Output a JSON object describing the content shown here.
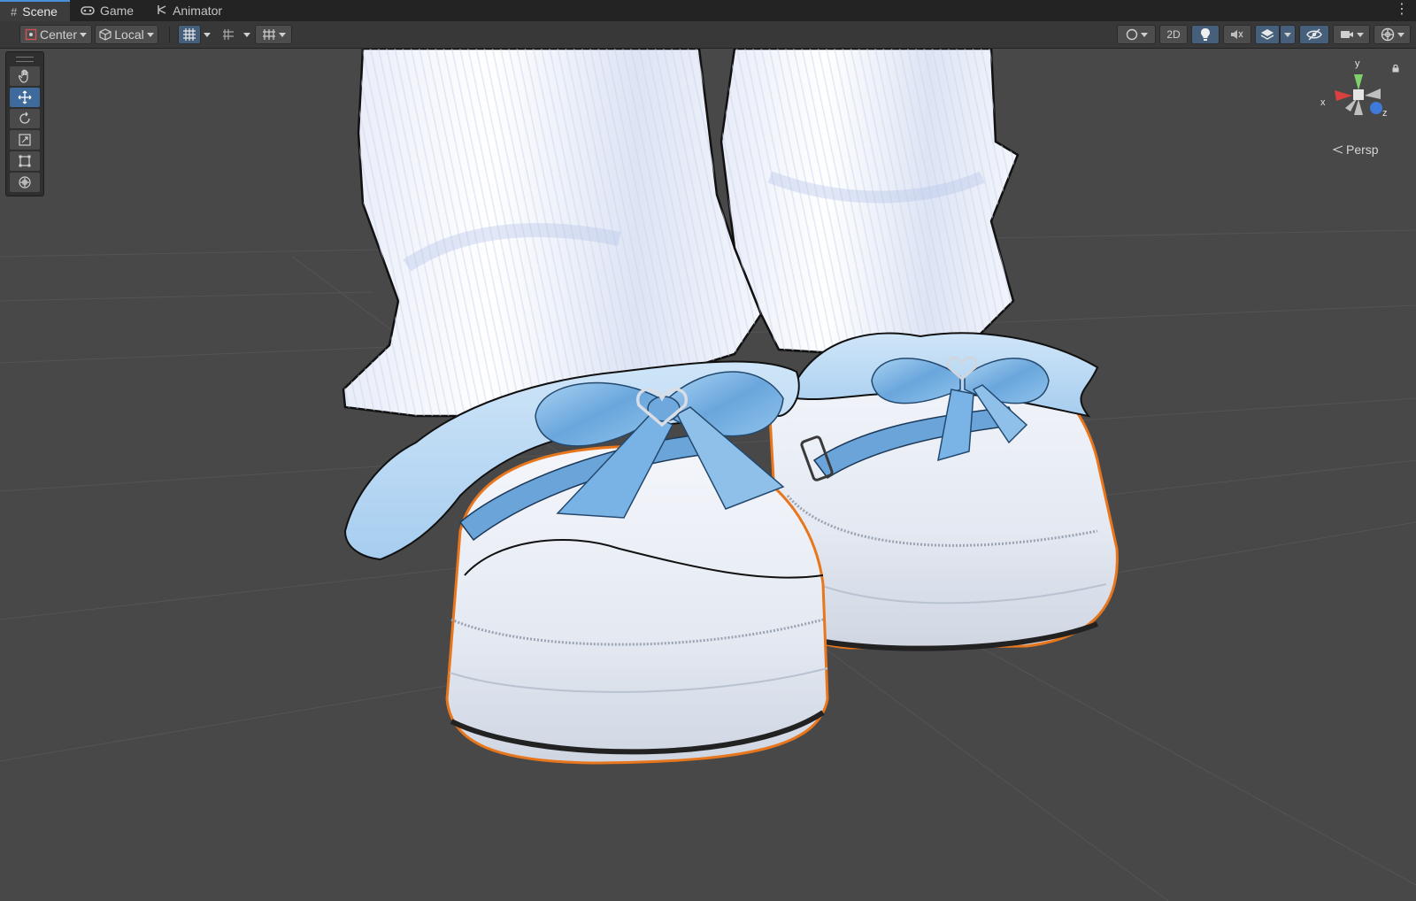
{
  "tabs": [
    {
      "label": "Scene",
      "icon": "hash-icon",
      "active": true
    },
    {
      "label": "Game",
      "icon": "gamepad-icon",
      "active": false
    },
    {
      "label": "Animator",
      "icon": "animator-icon",
      "active": false
    }
  ],
  "toolbar": {
    "pivot_label": "Center",
    "space_label": "Local",
    "mode_2d_label": "2D"
  },
  "tools": [
    "hand-tool",
    "move-tool",
    "rotate-tool",
    "scale-tool",
    "rect-tool",
    "transform-tool"
  ],
  "active_tool": "move-tool",
  "gizmo": {
    "y_label": "y",
    "x_label": "x",
    "z_label": "z",
    "projection_label": "Persp"
  },
  "colors": {
    "selection_outline": "#e8761c",
    "ribbon_blue": "#7fb6e6",
    "viewport_bg": "#484848",
    "axis_x": "#d94141",
    "axis_y": "#7fd16b",
    "axis_z": "#3e7ad9"
  }
}
